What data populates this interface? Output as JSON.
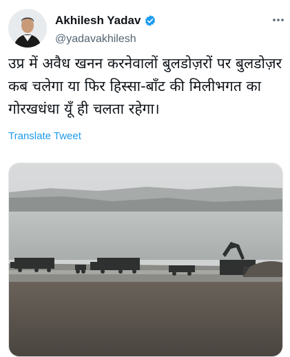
{
  "author": {
    "name": "Akhilesh Yadav",
    "handle": "@yadavakhilesh",
    "verified": true,
    "avatar_icon": "profile-photo"
  },
  "tweet": {
    "text": "उप्र में अवैध खनन करनेवालों बुलडोज़रों पर बुलडोज़र कब चलेगा या फिर हिस्सा-बाँट की मिलीभगत का गोरखधंधा यूँ ही चलता रहेगा।",
    "translate_label": "Translate Tweet"
  },
  "icons": {
    "verified": "verified-badge-icon",
    "more": "more-options-icon"
  },
  "colors": {
    "accent": "#1d9bf0",
    "text": "#0f1419",
    "secondary": "#536471"
  }
}
